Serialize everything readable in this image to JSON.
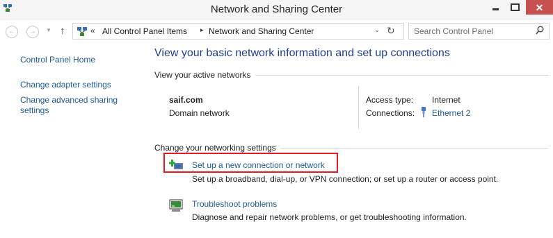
{
  "window": {
    "title": "Network and Sharing Center",
    "close_glyph": "✕",
    "accent_close": "#c75050"
  },
  "address_bar": {
    "overflow_chevron": "«",
    "breadcrumb": [
      "All Control Panel Items",
      "Network and Sharing Center"
    ],
    "separator": "▸",
    "search_placeholder": "Search Control Panel"
  },
  "nav": {
    "back_glyph": "←",
    "forward_glyph": "→",
    "recent_glyph": "▼",
    "up_glyph": "↑",
    "dropdown_glyph": "⌄",
    "refresh_glyph": "↻"
  },
  "left_pane": {
    "items": [
      {
        "label": "Control Panel Home"
      },
      {
        "label": "Change adapter settings"
      },
      {
        "label": "Change advanced sharing settings"
      }
    ]
  },
  "main": {
    "title": "View your basic network information and set up connections",
    "active_networks": {
      "heading": "View your active networks",
      "network_name": "saif.com",
      "network_category": "Domain network",
      "access_type_label": "Access type:",
      "access_type_value": "Internet",
      "connections_label": "Connections:",
      "connection_name": "Ethernet 2"
    },
    "change_settings": {
      "heading": "Change your networking settings",
      "tasks": [
        {
          "icon": "new-connection-icon",
          "title": "Set up a new connection or network",
          "description": "Set up a broadband, dial-up, or VPN connection; or set up a router or access point."
        },
        {
          "icon": "troubleshoot-icon",
          "title": "Troubleshoot problems",
          "description": "Diagnose and repair network problems, or get troubleshooting information."
        }
      ]
    }
  },
  "colors": {
    "link": "#1e5a95",
    "title": "#1e3f8f",
    "highlight": "#e21b24"
  }
}
